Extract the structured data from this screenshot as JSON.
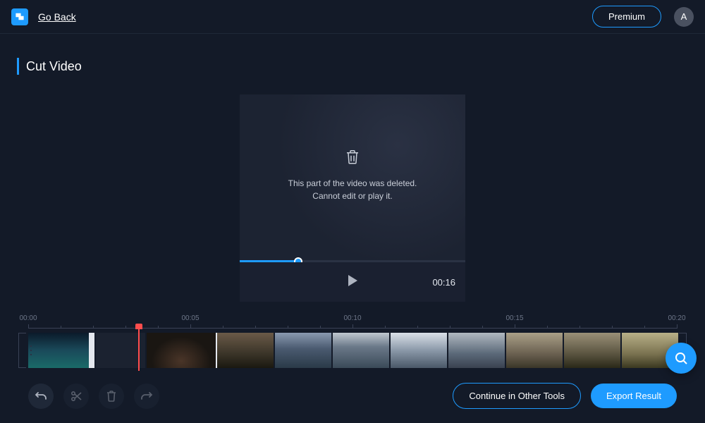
{
  "header": {
    "go_back": "Go Back",
    "premium": "Premium",
    "avatar_initial": "A"
  },
  "page": {
    "title": "Cut Video"
  },
  "preview": {
    "deleted_msg": "This part of the video was deleted.\nCannot edit or play it.",
    "duration": "00:16"
  },
  "timeline": {
    "labels": [
      "00:00",
      "00:05",
      "00:10",
      "00:15",
      "00:20"
    ]
  },
  "actions": {
    "continue": "Continue in Other Tools",
    "export": "Export Result"
  }
}
